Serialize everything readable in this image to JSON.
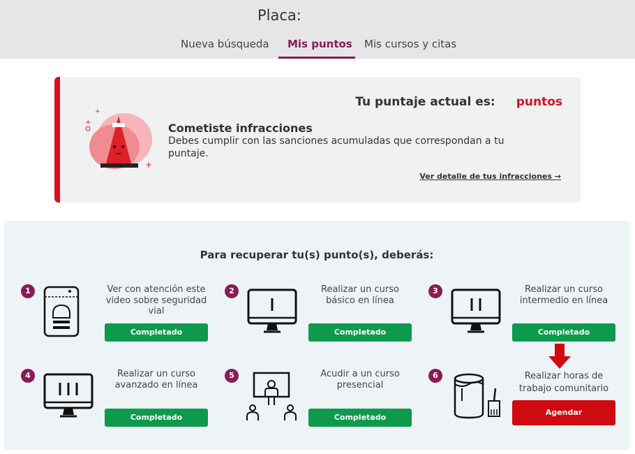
{
  "header": {
    "placa_label": "Placa:",
    "tabs": [
      {
        "label": "Nueva búsqueda",
        "active": false
      },
      {
        "label": "Mis puntos",
        "active": true
      },
      {
        "label": "Mis cursos y citas",
        "active": false
      }
    ]
  },
  "infractions": {
    "score_label": "Tu puntaje actual es:",
    "score_unit": "puntos",
    "title": "Cometiste infracciones",
    "description": "Debes cumplir con las sanciones acumuladas que correspondan a tu puntaje.",
    "link": "Ver detalle de tus infracciones",
    "link_arrow": "→",
    "icon": "traffic-cone-icon"
  },
  "recovery": {
    "title": "Para recuperar tu(s) punto(s), deberás:",
    "steps": [
      {
        "num": "1",
        "text": "Ver con atención este video sobre seguridad vial",
        "button": "Completado",
        "icon": "phone-video-icon"
      },
      {
        "num": "2",
        "text": "Realizar un curso básico en línea",
        "button": "Completado",
        "icon": "monitor-one-icon"
      },
      {
        "num": "3",
        "text": "Realizar un curso intermedio en línea",
        "button": "Completado",
        "icon": "monitor-two-icon"
      },
      {
        "num": "4",
        "text": "Realizar un curso avanzado en línea",
        "button": "Completado",
        "icon": "monitor-three-icon"
      },
      {
        "num": "5",
        "text": "Acudir a un curso presencial",
        "button": "Completado",
        "icon": "classroom-icon"
      },
      {
        "num": "6",
        "text": "Realizar     horas de trabajo comunitario",
        "button": "Agendar",
        "icon": "paint-bucket-icon"
      }
    ]
  },
  "colors": {
    "brand": "#8a1b55",
    "alert_red": "#d2131d",
    "success_green": "#0e9a4c"
  }
}
